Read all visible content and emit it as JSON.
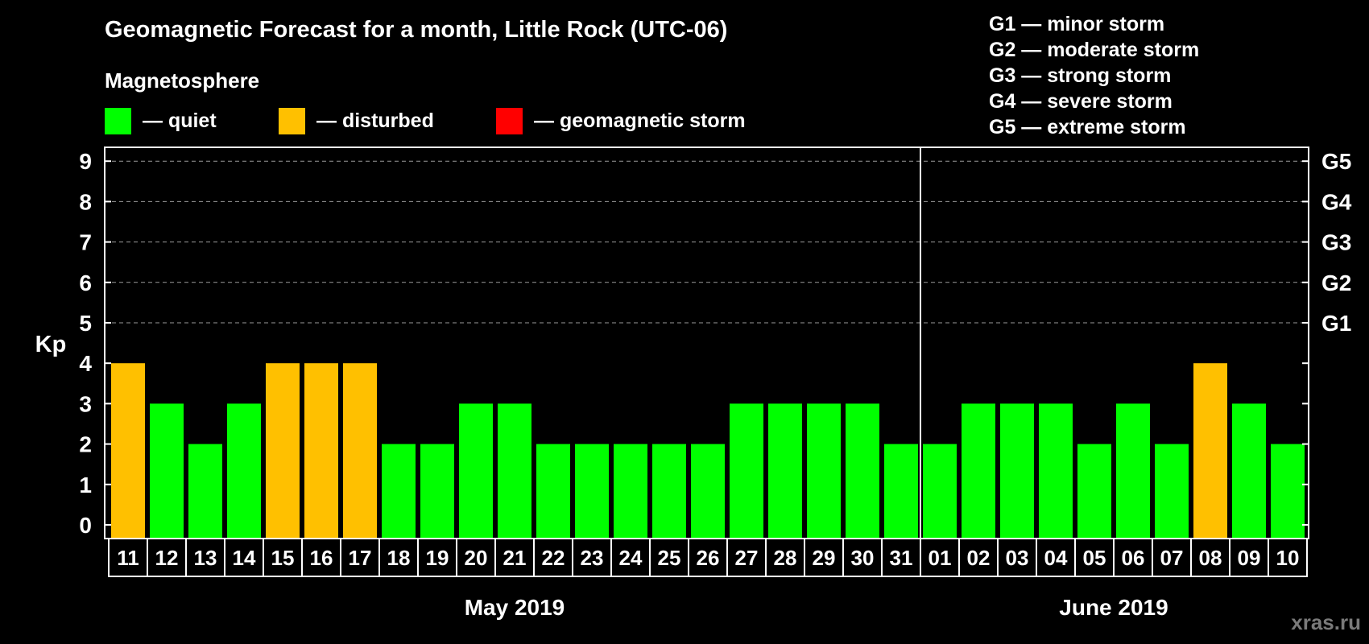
{
  "chart_data": {
    "type": "bar",
    "title": "Geomagnetic Forecast for a month, Little Rock (UTC-06)",
    "ylabel": "Kp",
    "ylim": [
      0,
      9
    ],
    "yticks": [
      "0",
      "1",
      "2",
      "3",
      "4",
      "5",
      "6",
      "7",
      "8",
      "9"
    ],
    "right_axis_labels": [
      {
        "kp": 5,
        "label": "G1"
      },
      {
        "kp": 6,
        "label": "G2"
      },
      {
        "kp": 7,
        "label": "G3"
      },
      {
        "kp": 8,
        "label": "G4"
      },
      {
        "kp": 9,
        "label": "G5"
      }
    ],
    "categories": [
      "11",
      "12",
      "13",
      "14",
      "15",
      "16",
      "17",
      "18",
      "19",
      "20",
      "21",
      "22",
      "23",
      "24",
      "25",
      "26",
      "27",
      "28",
      "29",
      "30",
      "31",
      "01",
      "02",
      "03",
      "04",
      "05",
      "06",
      "07",
      "08",
      "09",
      "10"
    ],
    "values": [
      4,
      3,
      2,
      3,
      4,
      4,
      4,
      2,
      2,
      3,
      3,
      2,
      2,
      2,
      2,
      2,
      3,
      3,
      3,
      3,
      2,
      2,
      3,
      3,
      3,
      2,
      3,
      2,
      4,
      3,
      2
    ],
    "months": [
      {
        "label": "May 2019",
        "first_index": 0,
        "last_index": 20
      },
      {
        "label": "June 2019",
        "first_index": 21,
        "last_index": 30
      }
    ],
    "legend_title": "Magnetosphere",
    "legend": [
      {
        "label": "— quiet",
        "color": "#00ff00"
      },
      {
        "label": "— disturbed",
        "color": "#ffc000"
      },
      {
        "label": "— geomagnetic storm",
        "color": "#ff0000"
      }
    ],
    "storm_scale": [
      "G1 — minor storm",
      "G2 — moderate storm",
      "G3 — strong storm",
      "G4 — severe storm",
      "G5 — extreme storm"
    ],
    "grid": true,
    "colors": {
      "quiet": "#00ff00",
      "disturbed": "#ffc000",
      "storm": "#ff0000"
    }
  },
  "watermark": "xras.ru"
}
